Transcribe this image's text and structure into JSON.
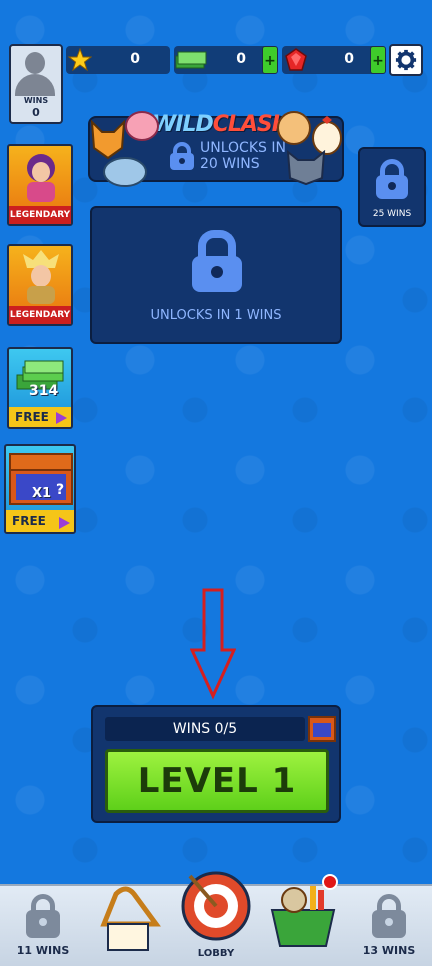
{
  "profile": {
    "wins_label": "WINS",
    "wins_value": "0"
  },
  "currencies": {
    "stars": "0",
    "cash": "0",
    "gems": "0",
    "plus": "+"
  },
  "side_offers": [
    {
      "badge": "LEGENDARY"
    },
    {
      "badge": "LEGENDARY"
    },
    {
      "amount": "314",
      "badge": "FREE"
    },
    {
      "amount": "X1",
      "badge": "FREE"
    }
  ],
  "event_banner": {
    "title_part1": "WILD",
    "title_part2": "CLASH",
    "unlock_text_line1": "UNLOCKS IN",
    "unlock_text_line2": "20 WINS"
  },
  "right_lock": {
    "label": "25 WINS"
  },
  "center_lock": {
    "label": "UNLOCKS IN 1 WINS"
  },
  "level_panel": {
    "wins_progress": "WINS 0/5",
    "level_button": "LEVEL 1"
  },
  "bottom_nav": {
    "left_locked": "11 WINS",
    "lobby": "LOBBY",
    "right_locked": "13 WINS"
  },
  "colors": {
    "background": "#1478df",
    "panel": "#12356e",
    "accent_green": "#5ed01a",
    "badge_red": "#cc1f1f",
    "badge_yellow": "#f5c518"
  }
}
